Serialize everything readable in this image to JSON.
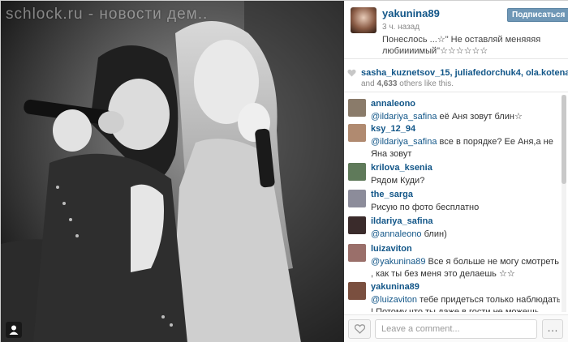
{
  "photo": {
    "watermark": "schlock.ru - новости дем.."
  },
  "post": {
    "owner": "yakunina89",
    "time_ago": "3 ч. назад",
    "caption_line1": "Понеслось ...☆\" Не оставляй меняяяя",
    "caption_line2": "любиииимый\"☆☆☆☆☆☆",
    "follow_label": "Подписаться"
  },
  "likes": {
    "likers": [
      "sasha_kuznetsov_15",
      "juliafedorchuk4",
      "ola.kotena"
    ],
    "others_prefix": "and",
    "others_count": "4,633",
    "others_suffix": "others like this."
  },
  "comments": [
    {
      "user": "annaleono",
      "mention": "@ildariya_safina",
      "text": " её Аня зовут блин☆",
      "avatar_color": "#8a7b6a"
    },
    {
      "user": "ksy_12_94",
      "mention": "@ildariya_safina",
      "text": " все в порядке? Ее Аня,а не Яна зовут",
      "avatar_color": "#b08a70"
    },
    {
      "user": "krilova_ksenia",
      "mention": "",
      "text": "Рядом Куди?",
      "avatar_color": "#5f7a5a"
    },
    {
      "user": "the_sarga",
      "mention": "",
      "text": "Рисую по фото бесплатно",
      "avatar_color": "#8c8c9a"
    },
    {
      "user": "ildariya_safina",
      "mention": "@annaleono",
      "text": " блин)",
      "avatar_color": "#3a2b2b"
    },
    {
      "user": "luizaviton",
      "mention": "@yakunina89",
      "text": " Все я больше не могу смотреть , как ты без меня это делаешь ☆☆",
      "avatar_color": "#9a6f6a"
    },
    {
      "user": "yakunina89",
      "mention": "@luizaviton",
      "text": " тебе придеться только наблюдать ! Потому что ты даже в гости не можешь приехать",
      "avatar_color": "#7a4f3f"
    }
  ],
  "footer": {
    "comment_placeholder": "Leave a comment...",
    "more_label": "…"
  }
}
